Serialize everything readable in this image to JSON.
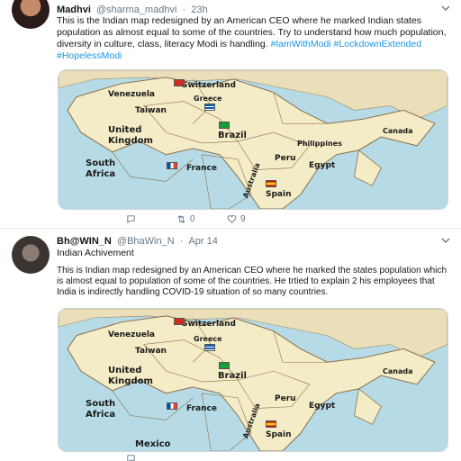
{
  "tweets": [
    {
      "display_name": "Madhvi",
      "handle": "@sharma_madhvi",
      "time": "23h",
      "text_parts": [
        {
          "t": "This is the Indian map redesigned by an American CEO where he marked Indian states population as almost equal to some of the countries. Try to understand how much population, diversity in culture, class, literacy Modi is handling. ",
          "hash": false
        },
        {
          "t": "#IamWithModi",
          "hash": true
        },
        {
          "t": " ",
          "hash": false
        },
        {
          "t": "#LockdownExtended",
          "hash": true
        },
        {
          "t": " ",
          "hash": false
        },
        {
          "t": "#HopelessModi",
          "hash": true
        }
      ],
      "reply_count": "",
      "retweet_count": "0",
      "like_count": "9"
    },
    {
      "display_name": "Bh@WIN_N",
      "handle": "@BhaWin_N",
      "time": "Apr 14",
      "subtitle": "Indian Achivement",
      "text": "This is Indian map redesigned by an American CEO where he marked the states population which is almost equal to population of some of the countries.  He trtied to explain 2 his employees that India is indirectly handling COVID-19 situation of so many countries."
    }
  ],
  "map_labels": {
    "switzerland": "Switzerland",
    "venezuela": "Venezuela",
    "greece": "Greece",
    "taiwan": "Taiwan",
    "united_kingdom_1": "United",
    "united_kingdom_2": "Kingdom",
    "brazil": "Brazil",
    "philippines": "Philippines",
    "canada": "Canada",
    "south_africa_1": "South",
    "south_africa_2": "Africa",
    "france": "France",
    "peru": "Peru",
    "egypt": "Egypt",
    "australia": "Australia",
    "spain": "Spain",
    "mexico": "Mexico"
  },
  "colors": {
    "link": "#1b95e0",
    "meta": "#657786",
    "sea": "#b6dbe6",
    "land": "#f4ecc6",
    "border": "#8a6e4a"
  },
  "icons": {
    "reply": "reply-icon",
    "retweet": "retweet-icon",
    "like": "heart-icon",
    "more": "chevron-down-icon"
  }
}
